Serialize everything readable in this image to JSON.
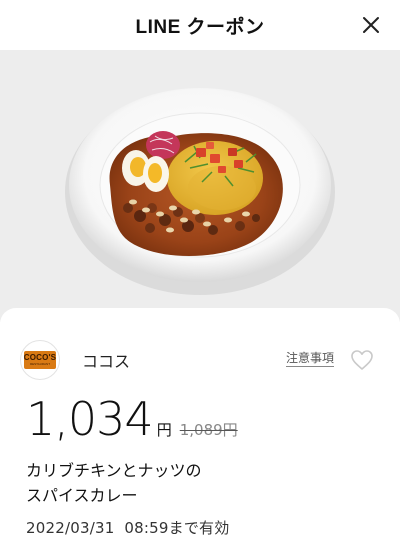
{
  "header": {
    "title": "LINE クーポン",
    "close_icon": "close-icon"
  },
  "hero": {
    "image": "curry-dish-photo"
  },
  "brand": {
    "logo_text": "COCO'S",
    "logo_sub": "RESTAURANT",
    "name": "ココス",
    "notice_label": "注意事項",
    "favorite_icon": "heart-outline-icon"
  },
  "offer": {
    "price": "1,034",
    "yen": "円",
    "original_price": "1,089円",
    "title_line1": "カリブチキンとナッツの",
    "title_line2": "スパイスカレー",
    "expiry": "2022/03/31  08:59まで有効"
  },
  "colors": {
    "background": "#ffffff",
    "hero_bg": "#ededed",
    "logo_orange": "#d97a14",
    "text": "#111111",
    "muted": "#888888"
  }
}
